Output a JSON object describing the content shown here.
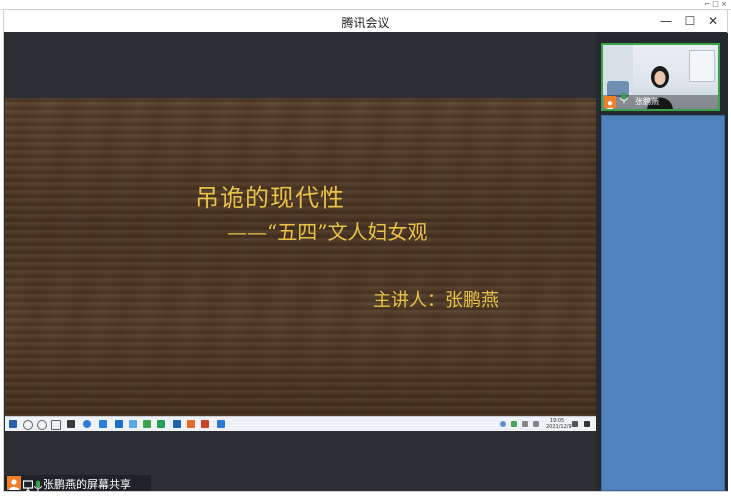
{
  "window": {
    "title": "腾讯会议",
    "minimize": "—",
    "maximize": "☐",
    "close": "✕"
  },
  "slide": {
    "title": "吊诡的现代性",
    "subtitle": "——“五四”文人妇女观",
    "speaker": "主讲人：张鹏燕"
  },
  "taskbar": {
    "time": "19:05",
    "date": "2021/12/9"
  },
  "participant": {
    "name": "张鹏燕"
  },
  "share_status": {
    "label": "张鹏燕的屏幕共享"
  },
  "colors": {
    "slide_text": "#e8c247",
    "accent_orange": "#f07f2c",
    "mic_green": "#3aa34a",
    "side_panel_blue": "#4f81bd"
  },
  "icons": [
    "avatar-icon",
    "screen-share-icon",
    "mic-icon",
    "minimize-icon",
    "maximize-icon",
    "close-icon"
  ]
}
